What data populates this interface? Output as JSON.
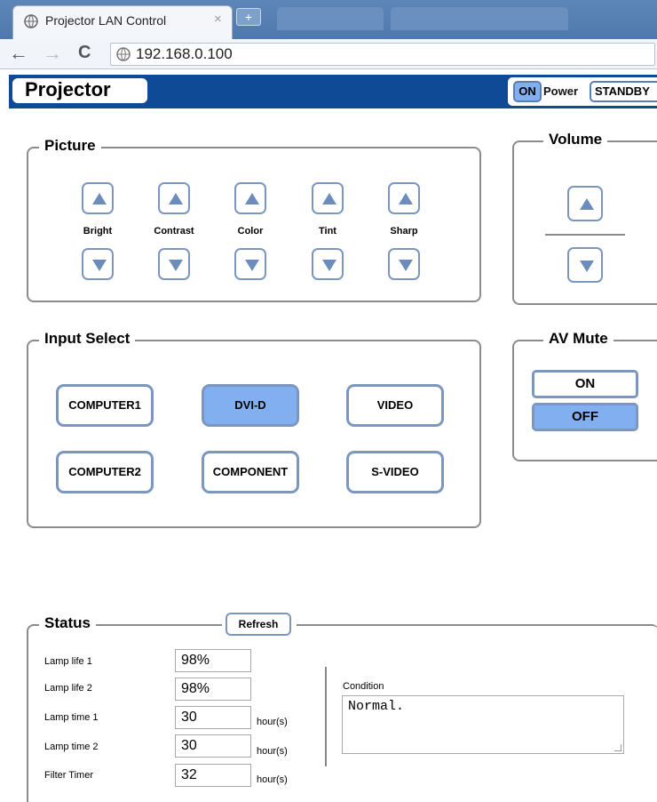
{
  "browser": {
    "tab_title": "Projector LAN Control",
    "tab_close": "×",
    "new_tab": "+",
    "url": "192.168.0.100",
    "back": "←",
    "forward": "→",
    "reload": "C"
  },
  "header": {
    "title": "Projector",
    "power_on": "ON",
    "power_label": "Power",
    "power_standby": "STANDBY"
  },
  "picture": {
    "legend": "Picture",
    "controls": [
      {
        "label": "Bright"
      },
      {
        "label": "Contrast"
      },
      {
        "label": "Color"
      },
      {
        "label": "Tint"
      },
      {
        "label": "Sharp"
      }
    ]
  },
  "volume": {
    "legend": "Volume"
  },
  "input_select": {
    "legend": "Input Select",
    "buttons": [
      "COMPUTER1",
      "DVI-D",
      "VIDEO",
      "COMPUTER2",
      "COMPONENT",
      "S-VIDEO"
    ],
    "selected": "DVI-D"
  },
  "av_mute": {
    "legend": "AV Mute",
    "on": "ON",
    "off": "OFF",
    "selected": "OFF"
  },
  "status": {
    "legend": "Status",
    "refresh": "Refresh",
    "rows": [
      {
        "label": "Lamp life 1",
        "value": "98%",
        "unit": ""
      },
      {
        "label": "Lamp life 2",
        "value": "98%",
        "unit": ""
      },
      {
        "label": "Lamp time 1",
        "value": "30",
        "unit": "hour(s)"
      },
      {
        "label": "Lamp time 2",
        "value": "30",
        "unit": "hour(s)"
      },
      {
        "label": "Filter Timer",
        "value": "32",
        "unit": "hour(s)"
      }
    ],
    "condition_label": "Condition",
    "condition_value": "Normal."
  },
  "colors": {
    "header_blue": "#0e4a96",
    "selected_blue": "#82aff0",
    "button_border": "#7b97bf"
  }
}
